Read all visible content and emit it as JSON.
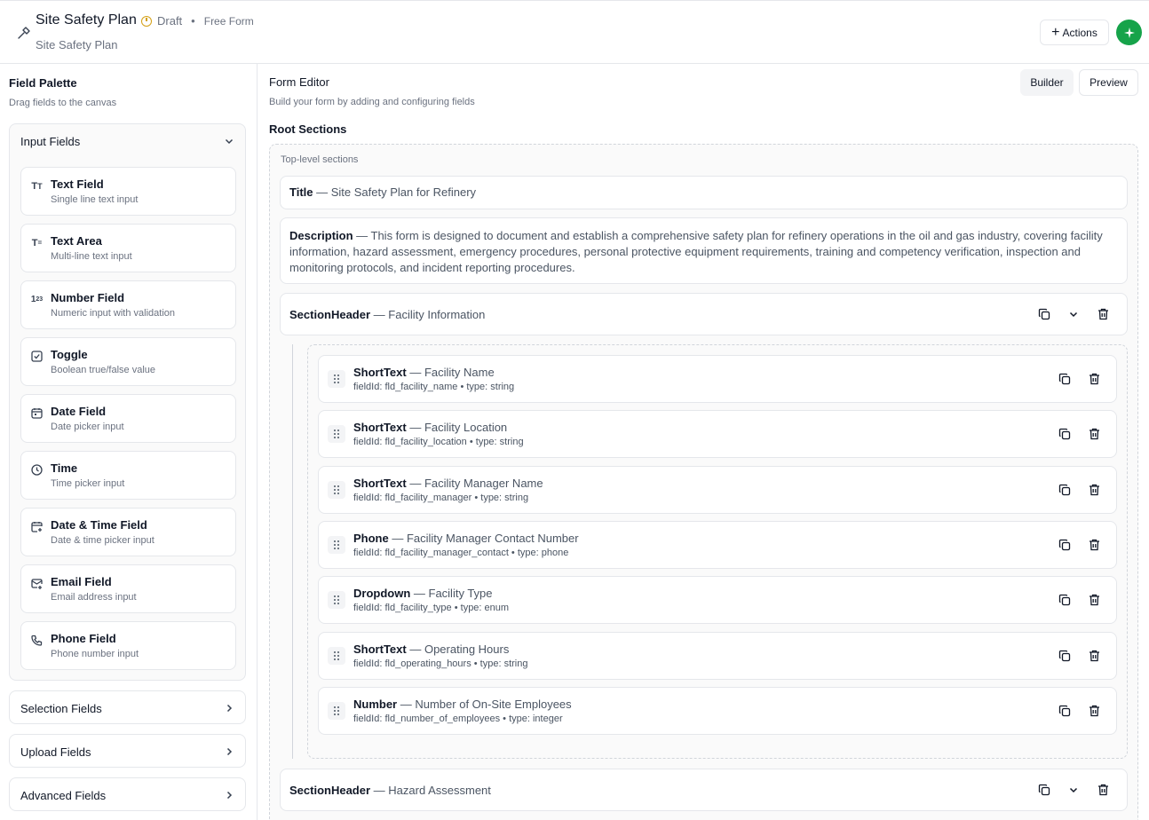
{
  "header": {
    "title": "Site Safety Plan",
    "status": "Draft",
    "separator": "•",
    "form_type": "Free Form",
    "subtitle": "Site Safety Plan",
    "actions_label": "Actions"
  },
  "palette": {
    "title": "Field Palette",
    "subtitle": "Drag fields to the canvas",
    "groups": [
      {
        "label": "Input Fields",
        "expanded": true
      },
      {
        "label": "Selection Fields",
        "expanded": false
      },
      {
        "label": "Upload Fields",
        "expanded": false
      },
      {
        "label": "Advanced Fields",
        "expanded": false
      }
    ],
    "items": [
      {
        "name": "Text Field",
        "desc": "Single line text input",
        "icon": "text-type-icon"
      },
      {
        "name": "Text Area",
        "desc": "Multi-line text input",
        "icon": "text-area-icon"
      },
      {
        "name": "Number Field",
        "desc": "Numeric input with validation",
        "icon": "number-icon"
      },
      {
        "name": "Toggle",
        "desc": "Boolean true/false value",
        "icon": "checkbox-icon"
      },
      {
        "name": "Date Field",
        "desc": "Date picker input",
        "icon": "calendar-icon"
      },
      {
        "name": "Time",
        "desc": "Time picker input",
        "icon": "clock-icon"
      },
      {
        "name": "Date & Time Field",
        "desc": "Date & time picker input",
        "icon": "calendar-clock-icon"
      },
      {
        "name": "Email Field",
        "desc": "Email address input",
        "icon": "mail-icon"
      },
      {
        "name": "Phone Field",
        "desc": "Phone number input",
        "icon": "phone-icon"
      }
    ]
  },
  "editor": {
    "title": "Form Editor",
    "subtitle": "Build your form by adding and configuring fields",
    "builder_label": "Builder",
    "preview_label": "Preview",
    "root_title": "Root Sections",
    "root_label": "Top-level sections",
    "title_card": {
      "type": "Title",
      "sep": " — ",
      "value": "Site Safety Plan for Refinery"
    },
    "desc_card": {
      "type": "Description",
      "sep": " — ",
      "value": "This form is designed to document and establish a comprehensive safety plan for refinery operations in the oil and gas industry, covering facility information, hazard assessment, emergency procedures, personal protective equipment requirements, training and competency verification, inspection and monitoring protocols, and incident reporting procedures."
    },
    "sections": [
      {
        "type": "SectionHeader",
        "sep": " — ",
        "value": "Facility Information"
      },
      {
        "type": "SectionHeader",
        "sep": " — ",
        "value": "Hazard Assessment"
      }
    ],
    "fields": [
      {
        "type": "ShortText",
        "sep": " — ",
        "label": "Facility Name",
        "meta": "fieldId: fld_facility_name • type: string"
      },
      {
        "type": "ShortText",
        "sep": " — ",
        "label": "Facility Location",
        "meta": "fieldId: fld_facility_location • type: string"
      },
      {
        "type": "ShortText",
        "sep": " — ",
        "label": "Facility Manager Name",
        "meta": "fieldId: fld_facility_manager • type: string"
      },
      {
        "type": "Phone",
        "sep": " — ",
        "label": "Facility Manager Contact Number",
        "meta": "fieldId: fld_facility_manager_contact • type: phone"
      },
      {
        "type": "Dropdown",
        "sep": " — ",
        "label": "Facility Type",
        "meta": "fieldId: fld_facility_type • type: enum"
      },
      {
        "type": "ShortText",
        "sep": " — ",
        "label": "Operating Hours",
        "meta": "fieldId: fld_operating_hours • type: string"
      },
      {
        "type": "Number",
        "sep": " — ",
        "label": "Number of On-Site Employees",
        "meta": "fieldId: fld_number_of_employees • type: integer"
      }
    ]
  },
  "colors": {
    "accent_green": "#16a34a",
    "draft_amber": "#d4a017",
    "border": "#e5e7eb"
  }
}
